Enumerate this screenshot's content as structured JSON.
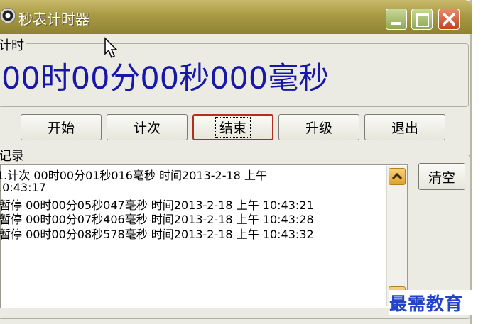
{
  "window": {
    "title": "秒表计时器",
    "app_icon": "stopwatch-icon",
    "controls": [
      "minimize-icon",
      "maximize-icon",
      "close-icon"
    ]
  },
  "timer_group": {
    "label": "计时",
    "display": "00时00分00秒000毫秒",
    "display_color": "#1717a8"
  },
  "buttons": [
    {
      "label": "开始"
    },
    {
      "label": "计次"
    },
    {
      "label": "结束",
      "focused": true
    },
    {
      "label": "升级"
    },
    {
      "label": "退出"
    }
  ],
  "records_group": {
    "label": "记录",
    "lines": [
      "1.计次 00时00分01秒016毫秒 时间2013-2-18 上午",
      "10:43:17",
      "暂停 00时00分05秒047毫秒 时间2013-2-18 上午 10:43:21",
      "暂停 00时00分07秒406毫秒 时间2013-2-18 上午 10:43:28",
      "暂停 00时00分08秒578毫秒 时间2013-2-18 上午 10:43:32"
    ],
    "clear_label": "清空"
  },
  "watermark": "最需教育",
  "colors": {
    "titlebar": "#a89a45",
    "window_bg": "#ecebe3",
    "accent_focus": "#b52d1c",
    "scroll_button": "#e0a12c"
  }
}
